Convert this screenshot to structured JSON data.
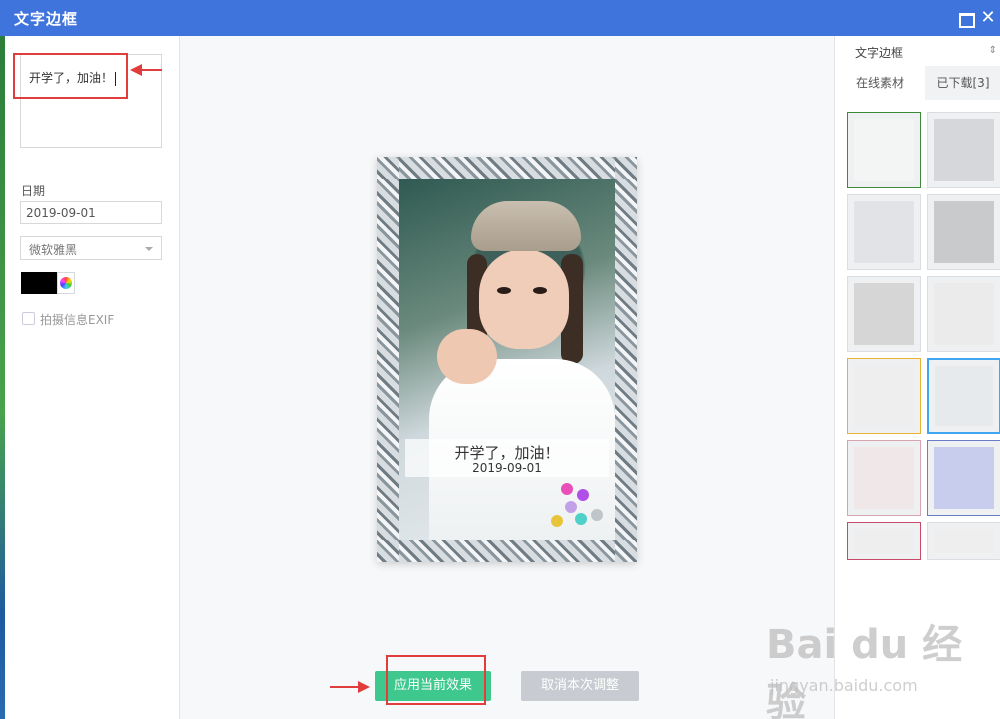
{
  "window": {
    "title": "文字边框"
  },
  "left_panel": {
    "text_value": "开学了，加油！",
    "date_label": "日期",
    "date_value": "2019-09-01",
    "font_select": "微软雅黑",
    "text_color": "#000000",
    "exif_label": "拍摄信息EXIF",
    "exif_checked": false
  },
  "preview": {
    "caption_main": "开学了，加油！",
    "caption_date": "2019-09-01"
  },
  "actions": {
    "apply_label": "应用当前效果",
    "cancel_label": "取消本次调整"
  },
  "right_panel": {
    "header": "文字边框",
    "tabs": [
      {
        "label": "在线素材",
        "active": true
      },
      {
        "label": "已下载[3]",
        "active": false
      }
    ],
    "selected_thumb": 7
  },
  "watermark": {
    "brand": "Bai du 经验",
    "url": "jingyan.baidu.com"
  },
  "colors": {
    "titlebar": "#3f74dc",
    "apply_button": "#3ec88e",
    "cancel_button": "#c8ccd2",
    "annotation": "#e23d3d",
    "selected_border": "#3fa5f0"
  },
  "icons": [
    "maximize-icon",
    "close-icon",
    "sort-icon",
    "color-wheel-icon",
    "dropdown-chevron-icon"
  ]
}
